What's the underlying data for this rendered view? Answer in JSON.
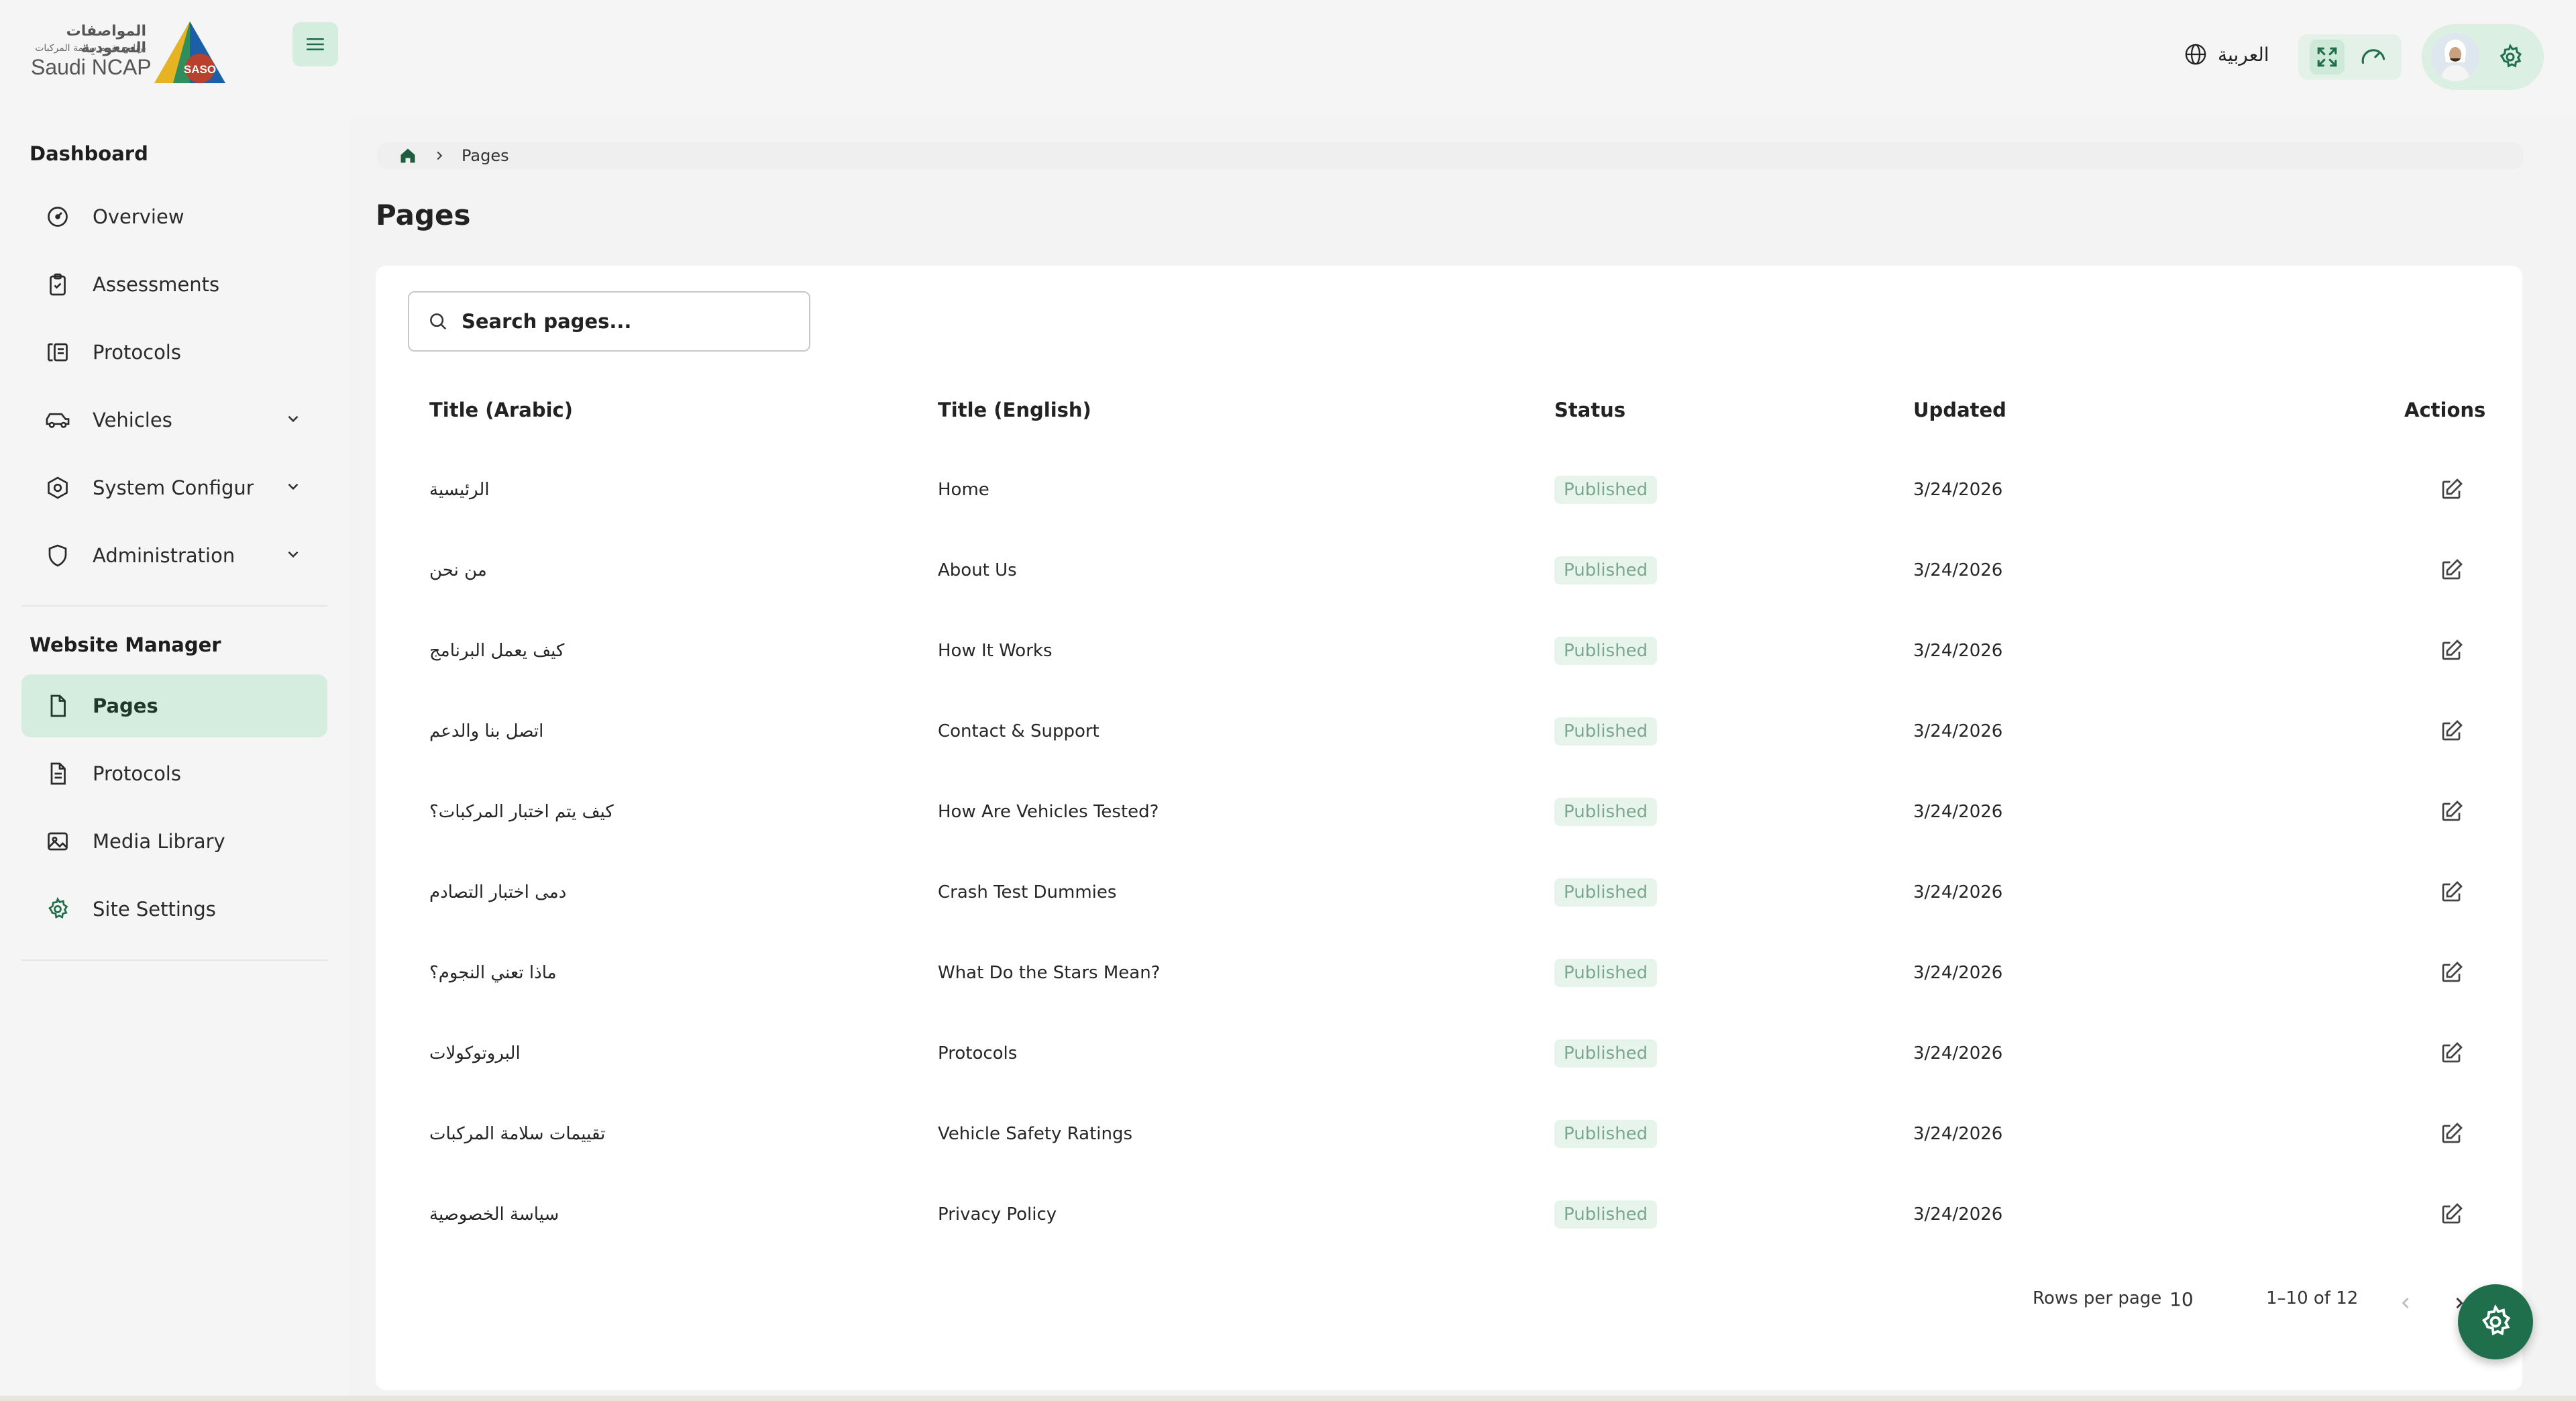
{
  "header": {
    "logo_ar_main": "المواصفات السعودية",
    "logo_ar_sub": "برنامج تقييم سلامة المركبات",
    "logo_en": "Saudi NCAP",
    "logo_badge": "SASO",
    "language_label": "العربية",
    "icons": [
      "menu-icon",
      "globe-icon",
      "fullscreen-icon",
      "gauge-icon",
      "settings-icon"
    ]
  },
  "sidebar": {
    "section1_title": "Dashboard",
    "section1_items": [
      {
        "label": "Overview",
        "icon": "gauge-icon"
      },
      {
        "label": "Assessments",
        "icon": "clipboard-icon"
      },
      {
        "label": "Protocols",
        "icon": "protocol-icon"
      },
      {
        "label": "Vehicles",
        "icon": "car-icon",
        "expandable": true
      },
      {
        "label": "System Configuration",
        "icon": "hexagon-settings-icon",
        "expandable": true
      },
      {
        "label": "Administration",
        "icon": "shield-icon",
        "expandable": true
      }
    ],
    "section2_title": "Website Manager",
    "section2_items": [
      {
        "label": "Pages",
        "icon": "file-icon",
        "active": true
      },
      {
        "label": "Protocols",
        "icon": "document-icon"
      },
      {
        "label": "Media Library",
        "icon": "image-icon"
      },
      {
        "label": "Site Settings",
        "icon": "gear-icon"
      }
    ]
  },
  "breadcrumb": {
    "current": "Pages"
  },
  "page_title": "Pages",
  "search": {
    "placeholder": "Search pages..."
  },
  "table": {
    "headers": {
      "title_ar": "Title (Arabic)",
      "title_en": "Title (English)",
      "status": "Status",
      "updated": "Updated",
      "actions": "Actions"
    },
    "rows": [
      {
        "title_ar": "الرئيسية",
        "title_en": "Home",
        "status": "Published",
        "updated": "3/24/2026"
      },
      {
        "title_ar": "من نحن",
        "title_en": "About Us",
        "status": "Published",
        "updated": "3/24/2026"
      },
      {
        "title_ar": "كيف يعمل البرنامج",
        "title_en": "How It Works",
        "status": "Published",
        "updated": "3/24/2026"
      },
      {
        "title_ar": "اتصل بنا والدعم",
        "title_en": "Contact & Support",
        "status": "Published",
        "updated": "3/24/2026"
      },
      {
        "title_ar": "كيف يتم اختبار المركبات؟",
        "title_en": "How Are Vehicles Tested?",
        "status": "Published",
        "updated": "3/24/2026"
      },
      {
        "title_ar": "دمى اختبار التصادم",
        "title_en": "Crash Test Dummies",
        "status": "Published",
        "updated": "3/24/2026"
      },
      {
        "title_ar": "ماذا تعني النجوم؟",
        "title_en": "What Do the Stars Mean?",
        "status": "Published",
        "updated": "3/24/2026"
      },
      {
        "title_ar": "البروتوكولات",
        "title_en": "Protocols",
        "status": "Published",
        "updated": "3/24/2026"
      },
      {
        "title_ar": "تقييمات سلامة المركبات",
        "title_en": "Vehicle Safety Ratings",
        "status": "Published",
        "updated": "3/24/2026"
      },
      {
        "title_ar": "سياسة الخصوصية",
        "title_en": "Privacy Policy",
        "status": "Published",
        "updated": "3/24/2026"
      }
    ]
  },
  "pagination": {
    "rows_per_page_label": "Rows per page",
    "rows_per_page": "10",
    "range": "1–10 of 12"
  },
  "colors": {
    "accent": "#1f6e4c",
    "accent_light": "#d4eddf",
    "badge_text": "#7aa78d",
    "badge_bg": "#e7f4ec"
  }
}
